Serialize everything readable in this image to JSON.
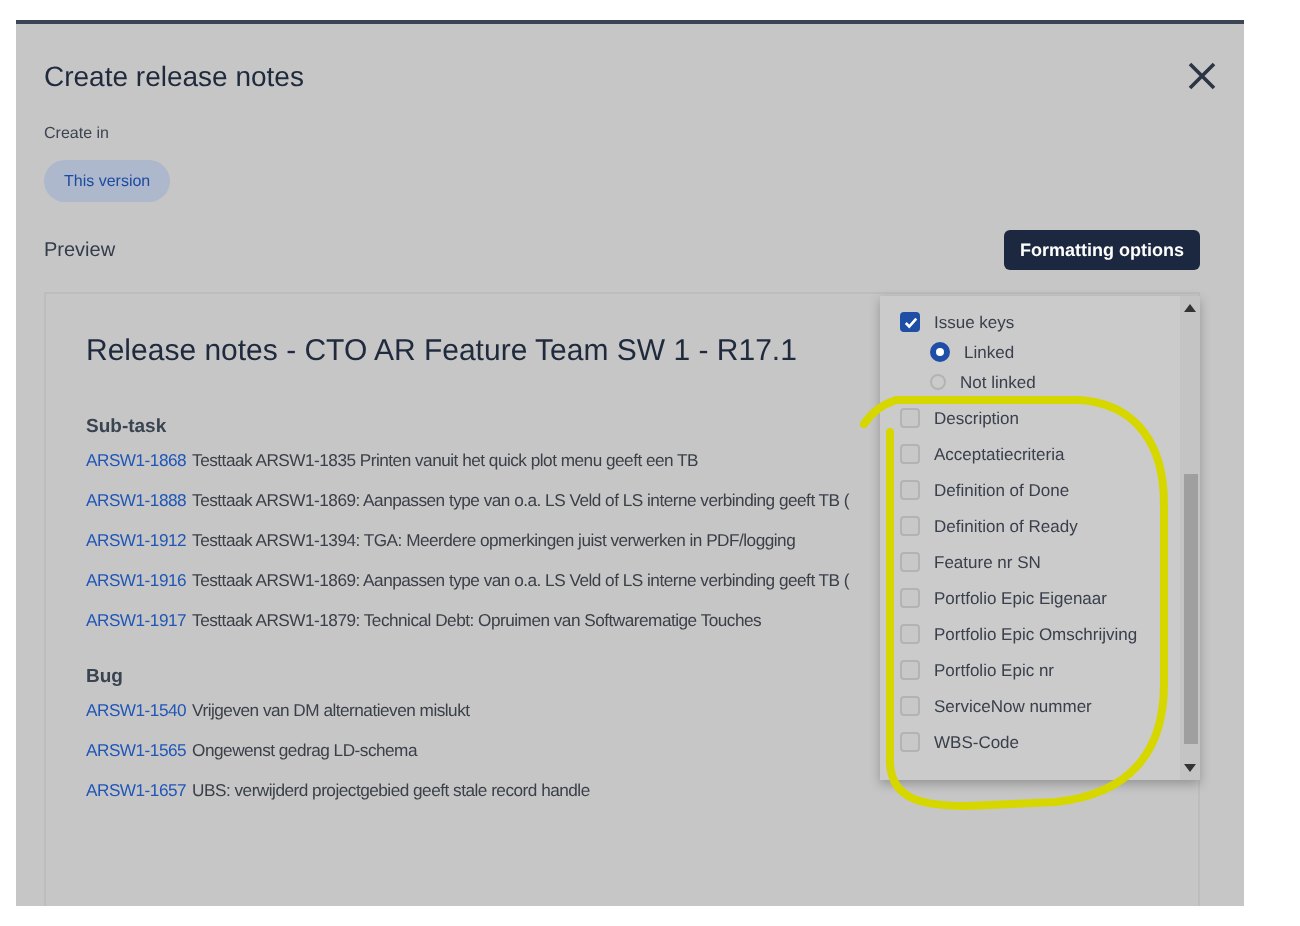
{
  "dialog": {
    "title": "Create release notes",
    "create_in_label": "Create in",
    "create_in_options": [
      {
        "label": "This version",
        "selected": true
      }
    ],
    "preview_label": "Preview",
    "formatting_button": "Formatting options"
  },
  "preview": {
    "heading": "Release notes - CTO AR Feature Team SW 1 - R17.1",
    "sections": [
      {
        "title": "Sub-task",
        "items": [
          {
            "key": "ARSW1-1868",
            "summary": "Testtaak ARSW1-1835 Printen vanuit het quick plot menu geeft een TB"
          },
          {
            "key": "ARSW1-1888",
            "summary": "Testtaak ARSW1-1869: Aanpassen type van o.a. LS Veld of LS interne verbinding geeft TB ("
          },
          {
            "key": "ARSW1-1912",
            "summary": "Testtaak ARSW1-1394: TGA: Meerdere opmerkingen juist verwerken in PDF/logging"
          },
          {
            "key": "ARSW1-1916",
            "summary": "Testtaak ARSW1-1869: Aanpassen type van o.a. LS Veld of LS interne verbinding geeft TB ("
          },
          {
            "key": "ARSW1-1917",
            "summary": "Testtaak ARSW1-1879: Technical Debt: Opruimen van Softwarematige Touches"
          }
        ]
      },
      {
        "title": "Bug",
        "items": [
          {
            "key": "ARSW1-1540",
            "summary": "Vrijgeven van DM alternatieven mislukt"
          },
          {
            "key": "ARSW1-1565",
            "summary": "Ongewenst gedrag LD-schema"
          },
          {
            "key": "ARSW1-1657",
            "summary": "UBS: verwijderd projectgebied geeft stale record handle"
          }
        ]
      }
    ]
  },
  "formatting_menu": {
    "options": [
      {
        "label": "Issue keys",
        "checked": true,
        "children": [
          {
            "label": "Linked",
            "selected": true
          },
          {
            "label": "Not linked",
            "selected": false
          }
        ]
      },
      {
        "label": "Description",
        "checked": false
      },
      {
        "label": "Acceptatiecriteria",
        "checked": false
      },
      {
        "label": "Definition of Done",
        "checked": false
      },
      {
        "label": "Definition of Ready",
        "checked": false
      },
      {
        "label": "Feature nr SN",
        "checked": false
      },
      {
        "label": "Portfolio Epic Eigenaar",
        "checked": false
      },
      {
        "label": "Portfolio Epic Omschrijving",
        "checked": false
      },
      {
        "label": "Portfolio Epic nr",
        "checked": false
      },
      {
        "label": "ServiceNow nummer",
        "checked": false
      },
      {
        "label": "WBS-Code",
        "checked": false
      }
    ]
  }
}
